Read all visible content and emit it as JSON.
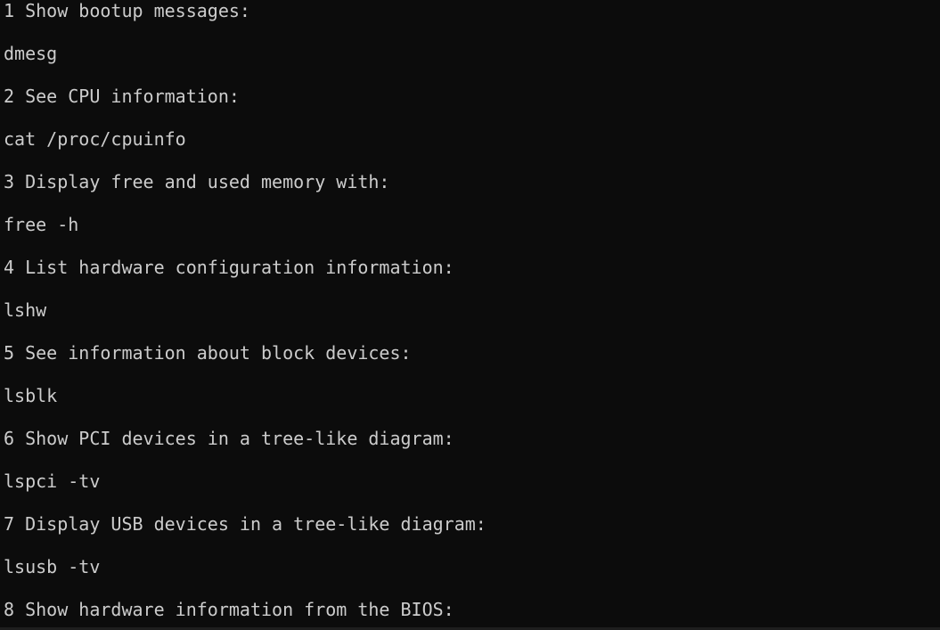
{
  "terminal": {
    "lines": [
      "1 Show bootup messages:",
      "dmesg",
      "2 See CPU information:",
      "cat /proc/cpuinfo",
      "3 Display free and used memory with:",
      "free -h",
      "4 List hardware configuration information:",
      "lshw",
      "5 See information about block devices:",
      "lsblk",
      "6 Show PCI devices in a tree-like diagram:",
      "lspci -tv",
      "7 Display USB devices in a tree-like diagram:",
      "lsusb -tv",
      "8 Show hardware information from the BIOS:"
    ]
  },
  "colors": {
    "background": "#0c0c0c",
    "text": "#cccccc"
  }
}
